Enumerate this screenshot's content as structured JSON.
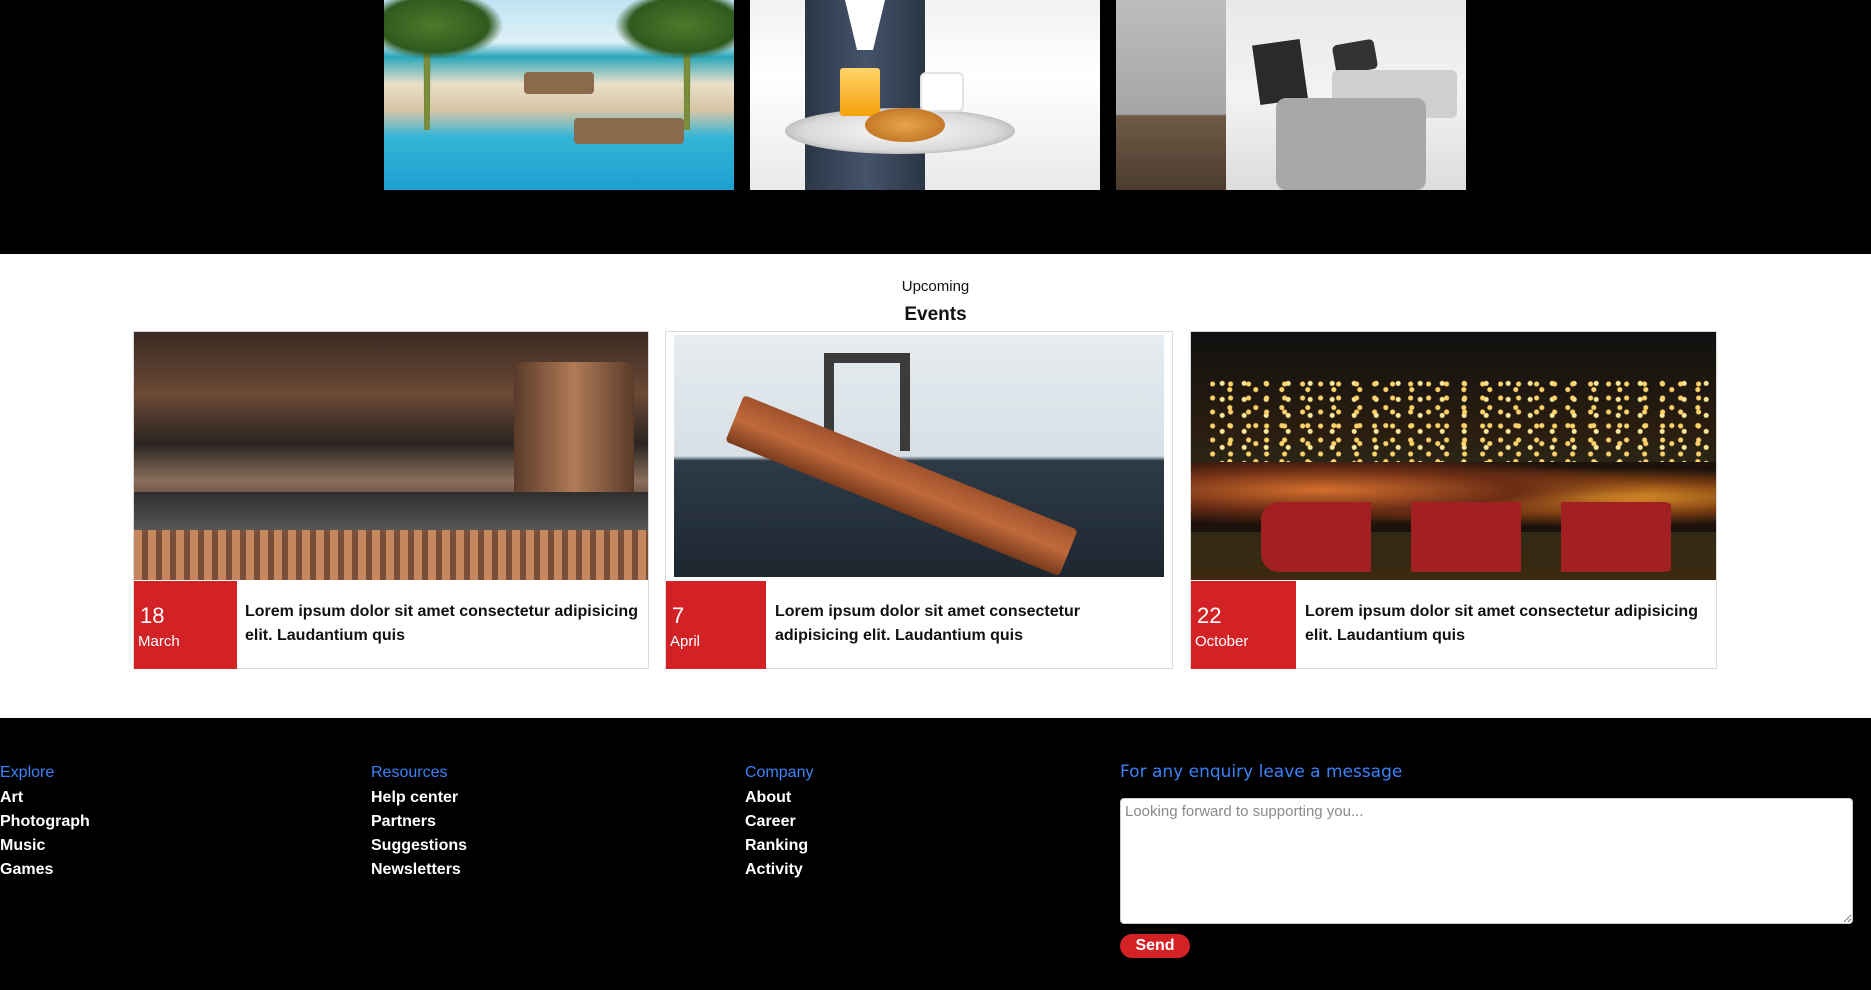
{
  "gallery": {
    "images": [
      {
        "name": "beach-pool-image"
      },
      {
        "name": "breakfast-tray-image"
      },
      {
        "name": "hotel-bed-image"
      }
    ]
  },
  "events": {
    "kicker": "Upcoming",
    "title": "Events",
    "cards": [
      {
        "day": "18",
        "month": "March",
        "description": "Lorem ipsum dolor sit amet consectetur adipisicing elit. Laudantium quis"
      },
      {
        "day": "7",
        "month": "April",
        "description": "Lorem ipsum dolor sit amet consectetur adipisicing elit. Laudantium quis"
      },
      {
        "day": "22",
        "month": "October",
        "description": "Lorem ipsum dolor sit amet consectetur adipisicing elit. Laudantium quis"
      }
    ]
  },
  "footer": {
    "columns": [
      {
        "heading": "Explore",
        "links": [
          "Art",
          "Photograph",
          "Music",
          "Games"
        ]
      },
      {
        "heading": "Resources",
        "links": [
          "Help center",
          "Partners",
          "Suggestions",
          "Newsletters"
        ]
      },
      {
        "heading": "Company",
        "links": [
          "About",
          "Career",
          "Ranking",
          "Activity"
        ]
      }
    ],
    "enquiry": {
      "heading": "For any enquiry leave a message",
      "placeholder": "Looking forward to supporting you...",
      "value": "",
      "send_label": "Send"
    }
  },
  "colors": {
    "accent_red": "#d32226",
    "link_blue": "#3b82f6",
    "background": "#000000"
  }
}
